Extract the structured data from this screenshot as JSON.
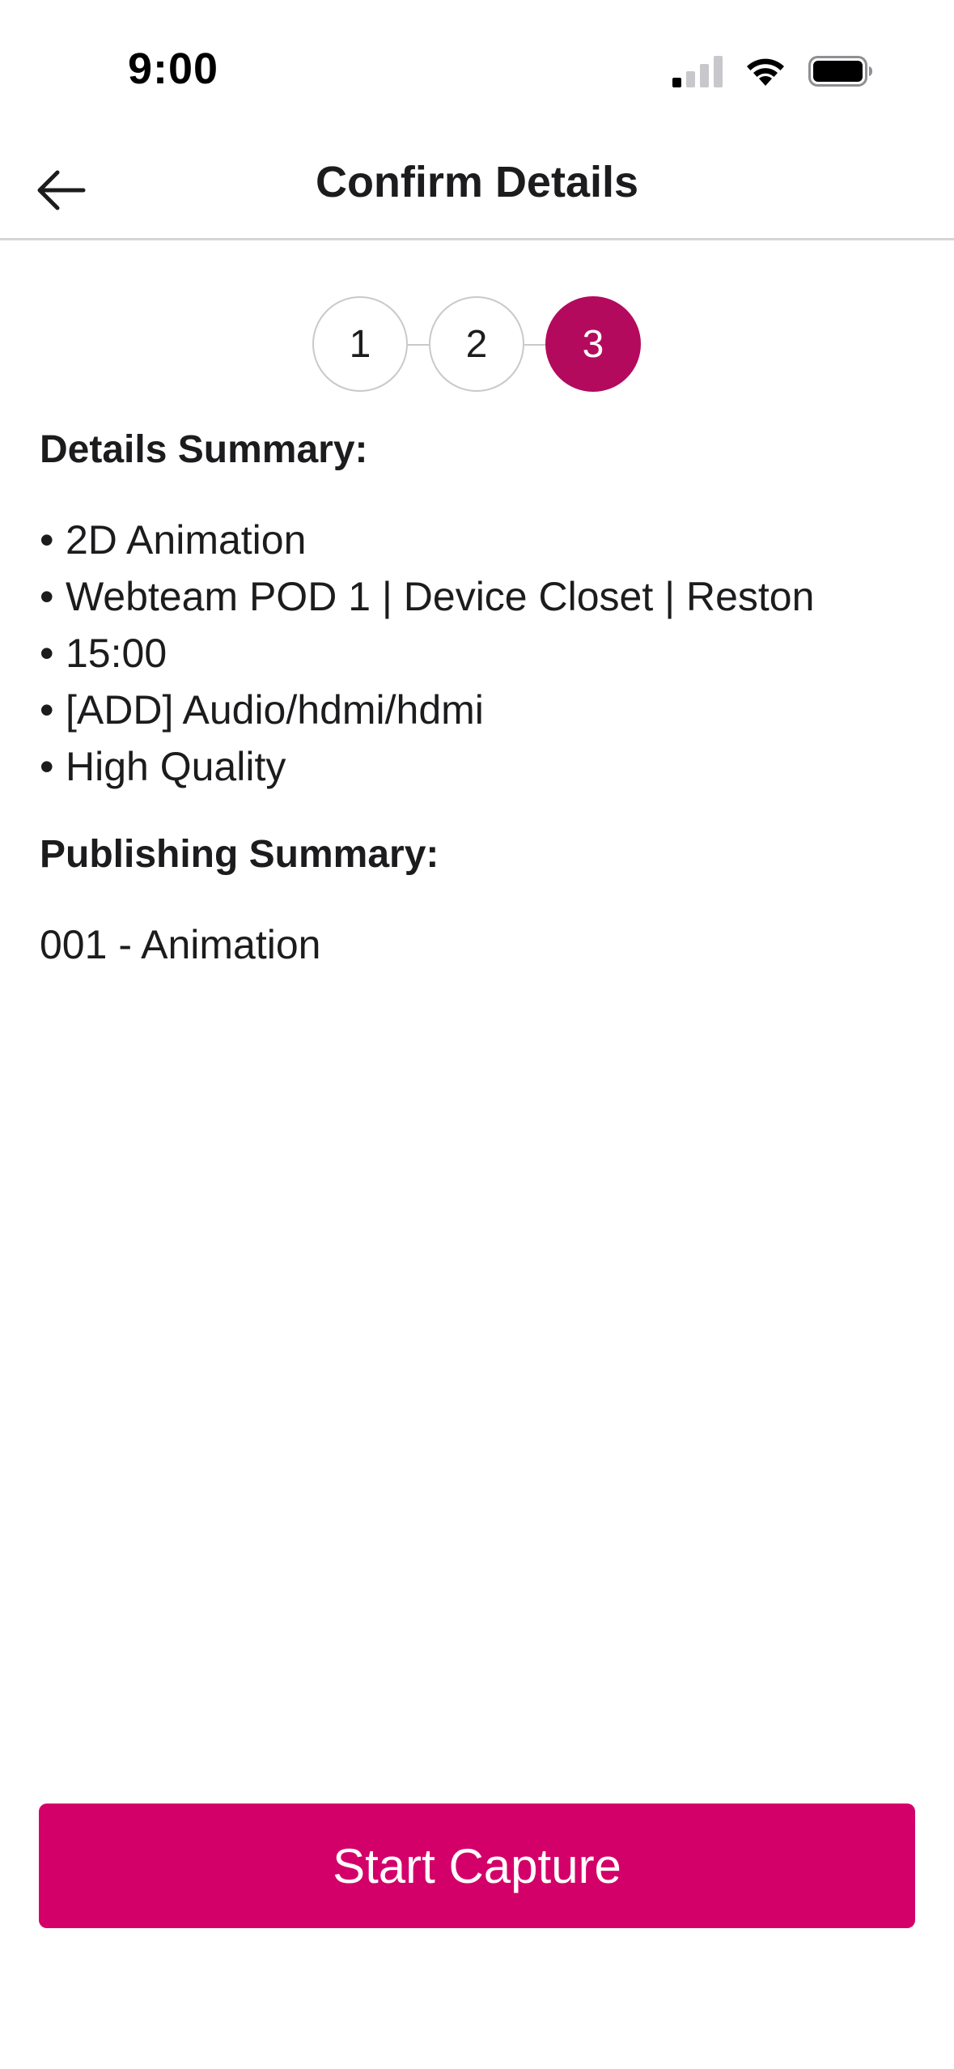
{
  "status_bar": {
    "time": "9:00",
    "icons": [
      "cellular-signal-icon",
      "wifi-icon",
      "battery-icon"
    ]
  },
  "header": {
    "title": "Confirm Details",
    "back_icon": "arrow-left-icon"
  },
  "stepper": {
    "steps": [
      "1",
      "2",
      "3"
    ],
    "active_step": 3,
    "active_color": "#b30a5e"
  },
  "details": {
    "heading": "Details Summary:",
    "bullet": "•",
    "items": [
      "2D Animation",
      "Webteam POD 1 | Device Closet | Reston",
      "15:00",
      "[ADD] Audio/hdmi/hdmi",
      "High Quality"
    ]
  },
  "publishing": {
    "heading": "Publishing Summary:",
    "value": "001 - Animation"
  },
  "cta": {
    "label": "Start Capture",
    "color": "#d4006a"
  }
}
